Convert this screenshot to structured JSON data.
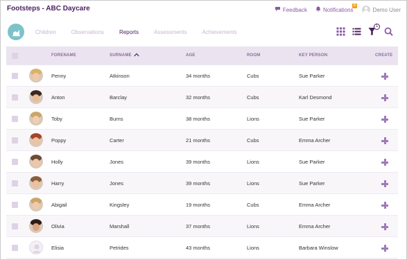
{
  "app": {
    "title": "Footsteps - ABC Daycare"
  },
  "header": {
    "feedback_label": "Feedback",
    "notifications_label": "Notifications",
    "notifications_count": "8",
    "user_label": "Demo User"
  },
  "nav": {
    "tabs": [
      {
        "label": "Children",
        "active": false
      },
      {
        "label": "Observations",
        "active": false
      },
      {
        "label": "Reports",
        "active": true
      },
      {
        "label": "Assessments",
        "active": false
      },
      {
        "label": "Achievements",
        "active": false
      }
    ],
    "filter_count": "1"
  },
  "table": {
    "columns": {
      "forename": "FORENAME",
      "surname": "SURNAME",
      "age": "AGE",
      "room": "ROOM",
      "key_person": "KEY PERSON",
      "create": "CREATE"
    },
    "rows": [
      {
        "forename": "Penny",
        "surname": "Atkinson",
        "age": "34 months",
        "room": "Cubs",
        "key_person": "Sue Parker",
        "avatar": "girl-photo"
      },
      {
        "forename": "Anton",
        "surname": "Barclay",
        "age": "32 months",
        "room": "Cubs",
        "key_person": "Karl Desmond",
        "avatar": "boy-photo"
      },
      {
        "forename": "Toby",
        "surname": "Burns",
        "age": "38 months",
        "room": "Lions",
        "key_person": "Sue Parker",
        "avatar": "boy-photo"
      },
      {
        "forename": "Poppy",
        "surname": "Carter",
        "age": "21 months",
        "room": "Cubs",
        "key_person": "Emma Archer",
        "avatar": "girl-photo"
      },
      {
        "forename": "Holly",
        "surname": "Jones",
        "age": "39 months",
        "room": "Lions",
        "key_person": "Sue Parker",
        "avatar": "girl-photo"
      },
      {
        "forename": "Harry",
        "surname": "Jones",
        "age": "39 months",
        "room": "Lions",
        "key_person": "Sue Parker",
        "avatar": "boy-photo"
      },
      {
        "forename": "Abigail",
        "surname": "Kingsley",
        "age": "19 months",
        "room": "Cubs",
        "key_person": "Emma Archer",
        "avatar": "girl-photo"
      },
      {
        "forename": "Olivia",
        "surname": "Marshall",
        "age": "37 months",
        "room": "Lions",
        "key_person": "Emma Archer",
        "avatar": "girl-photo"
      },
      {
        "forename": "Elisia",
        "surname": "Petrides",
        "age": "43 months",
        "room": "Lions",
        "key_person": "Barbara Winslow",
        "avatar": "placeholder"
      }
    ]
  },
  "colors": {
    "brand": "#4a2060",
    "accent": "#a07ab5",
    "logo": "#7cc3c9",
    "badge": "#f4a020"
  }
}
